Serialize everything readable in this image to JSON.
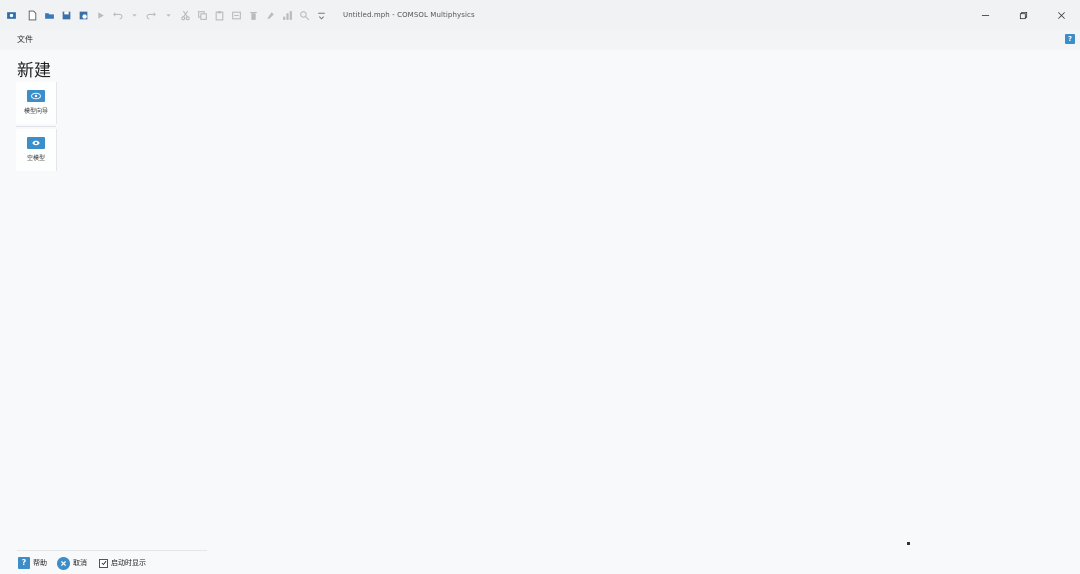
{
  "window": {
    "title": "Untitled.mph - COMSOL Multiphysics"
  },
  "toolbar": {
    "icons": [
      "app-icon",
      "new-icon",
      "open-icon",
      "save-icon",
      "save-as-icon",
      "run-icon",
      "undo-icon",
      "redo-icon",
      "cut-icon",
      "copy-icon",
      "paste-icon",
      "duplicate-icon",
      "delete-icon",
      "build-icon",
      "compute-icon",
      "zoom-icon",
      "customize-icon"
    ]
  },
  "menu": {
    "file_label": "文件",
    "help_label": "?"
  },
  "page": {
    "title": "新建"
  },
  "tiles": [
    {
      "label": "模型向导",
      "icon": "model-wizard-icon"
    },
    {
      "label": "空模型",
      "icon": "blank-model-icon"
    }
  ],
  "bottom": {
    "help_label": "帮助",
    "cancel_label": "取消",
    "show_on_startup_label": "启动时显示",
    "show_on_startup_checked": true
  },
  "colors": {
    "accent": "#3c8dc8",
    "background": "#f7f9fb"
  }
}
